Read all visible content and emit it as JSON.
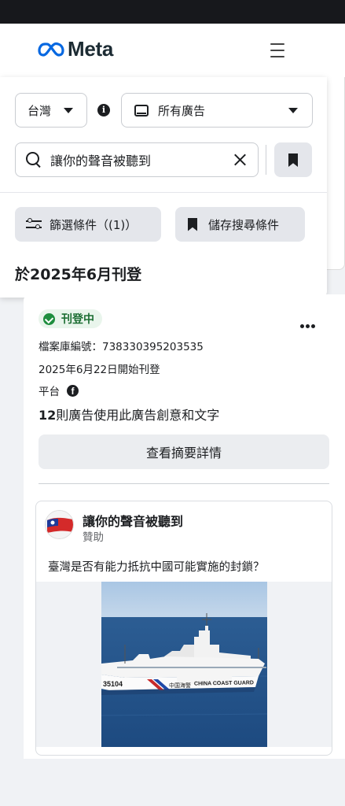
{
  "header": {
    "brand": "Meta",
    "brand_color": "#0668E1",
    "menu_icon": "hamburger-menu-icon"
  },
  "search_panel": {
    "country_label": "台灣",
    "ad_type_label": "所有廣告",
    "search_value": "讓你的聲音被聽到",
    "filter_button_label": "篩選條件（(1)）",
    "save_search_label": "儲存搜尋條件",
    "date_heading": "於2025年6月刊登"
  },
  "ad_card": {
    "status_label": "刊登中",
    "status_color": "#1e8e3e",
    "library_id": "檔案庫編號：738330395203535",
    "start_date": "2025年6月22日開始刊登",
    "platform_label": "平台",
    "platform_icon": "facebook-icon",
    "count_number": "12",
    "count_text": "則廣告使用此廣告創意和文字",
    "summary_button": "查看摘要詳情"
  },
  "ad_preview": {
    "page_name": "讓你的聲音被聽到",
    "sponsored_label": "贊助",
    "body_text": "臺灣是否有能力抵抗中國可能實施的封鎖？",
    "image_hull_number": "35104",
    "image_hull_text_cn": "中国海警",
    "image_hull_text_en": "CHINA COAST GUARD"
  }
}
